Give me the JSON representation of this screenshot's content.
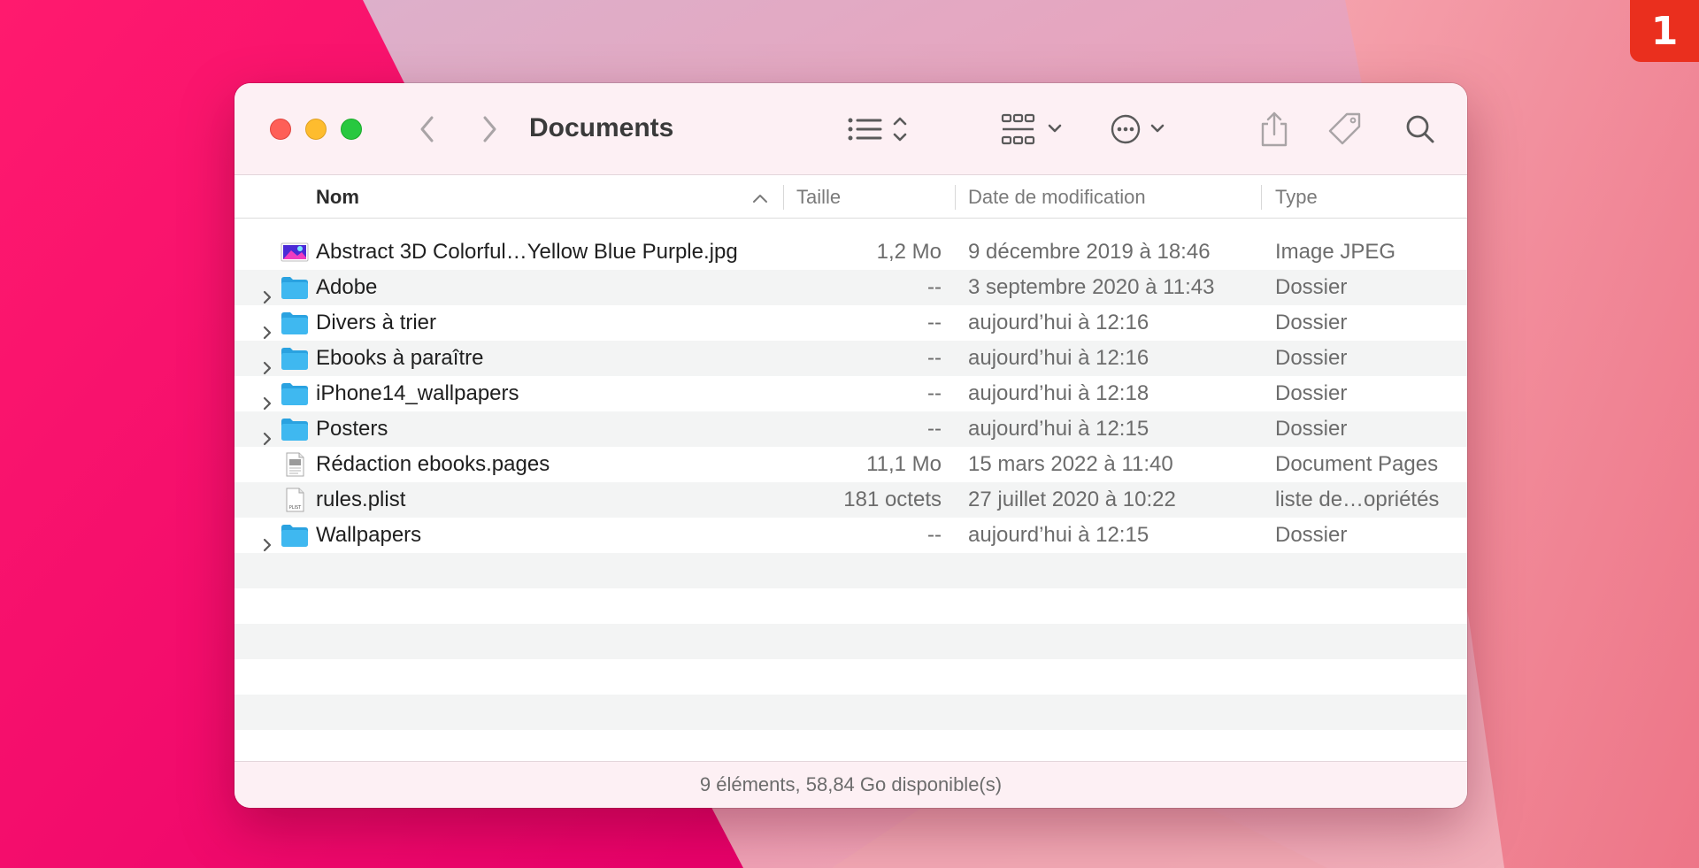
{
  "badge": "1",
  "window": {
    "title": "Documents"
  },
  "toolbar": {
    "back_icon": "chevron-left-icon",
    "forward_icon": "chevron-right-icon",
    "view_icon": "list-view-icon",
    "group_icon": "grid-group-icon",
    "more_icon": "ellipsis-circle-icon",
    "share_icon": "share-icon",
    "tag_icon": "tag-icon",
    "search_icon": "search-icon"
  },
  "columns": {
    "name": "Nom",
    "size": "Taille",
    "date": "Date de modification",
    "type": "Type"
  },
  "files": [
    {
      "name": "Abstract 3D Colorful…Yellow Blue Purple.jpg",
      "size": "1,2 Mo",
      "date": "9 décembre 2019 à 18:46",
      "type": "Image JPEG",
      "kind": "image",
      "expandable": false
    },
    {
      "name": "Adobe",
      "size": "--",
      "date": "3 septembre 2020 à 11:43",
      "type": "Dossier",
      "kind": "folder",
      "expandable": true
    },
    {
      "name": "Divers à trier",
      "size": "--",
      "date": "aujourd’hui à 12:16",
      "type": "Dossier",
      "kind": "folder",
      "expandable": true
    },
    {
      "name": "Ebooks à paraître",
      "size": "--",
      "date": "aujourd’hui à 12:16",
      "type": "Dossier",
      "kind": "folder",
      "expandable": true
    },
    {
      "name": "iPhone14_wallpapers",
      "size": "--",
      "date": "aujourd’hui à 12:18",
      "type": "Dossier",
      "kind": "folder",
      "expandable": true
    },
    {
      "name": "Posters",
      "size": "--",
      "date": "aujourd’hui à 12:15",
      "type": "Dossier",
      "kind": "folder",
      "expandable": true
    },
    {
      "name": "Rédaction ebooks.pages",
      "size": "11,1 Mo",
      "date": "15 mars 2022 à 11:40",
      "type": "Document Pages",
      "kind": "pages",
      "expandable": false
    },
    {
      "name": "rules.plist",
      "size": "181 octets",
      "date": "27 juillet 2020 à 10:22",
      "type": "liste de…opriétés",
      "kind": "plist",
      "expandable": false
    },
    {
      "name": "Wallpapers",
      "size": "--",
      "date": "aujourd’hui à 12:15",
      "type": "Dossier",
      "kind": "folder",
      "expandable": true
    }
  ],
  "plist_icon_label": "PLIST",
  "status": "9 éléments, 58,84 Go disponible(s)",
  "colors": {
    "folder": "#3fb8f0",
    "folder_tab": "#2aa2e0",
    "accent_red": "#ea2f1e"
  }
}
